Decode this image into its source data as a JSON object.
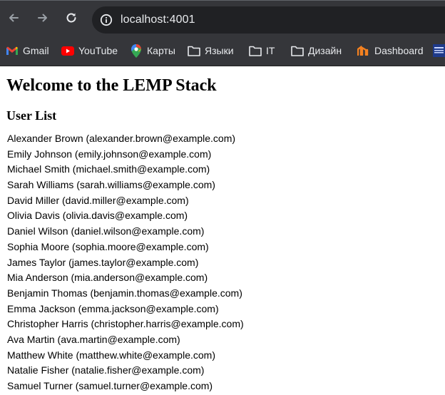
{
  "browser": {
    "url": "localhost:4001",
    "bookmarks": [
      {
        "label": "Gmail",
        "icon": "gmail-icon"
      },
      {
        "label": "YouTube",
        "icon": "youtube-icon"
      },
      {
        "label": "Карты",
        "icon": "maps-icon"
      },
      {
        "label": "Языки",
        "icon": "folder-icon"
      },
      {
        "label": "IT",
        "icon": "folder-icon"
      },
      {
        "label": "Дизайн",
        "icon": "folder-icon"
      },
      {
        "label": "Dashboard",
        "icon": "dashboard-icon"
      }
    ],
    "colors": {
      "chrome_bg": "#35363a",
      "omnibox_bg": "#202124",
      "text": "#e8eaed"
    }
  },
  "page": {
    "title": "Welcome to the LEMP Stack",
    "subtitle": "User List",
    "users": [
      "Alexander Brown (alexander.brown@example.com)",
      "Emily Johnson (emily.johnson@example.com)",
      "Michael Smith (michael.smith@example.com)",
      "Sarah Williams (sarah.williams@example.com)",
      "David Miller (david.miller@example.com)",
      "Olivia Davis (olivia.davis@example.com)",
      "Daniel Wilson (daniel.wilson@example.com)",
      "Sophia Moore (sophia.moore@example.com)",
      "James Taylor (james.taylor@example.com)",
      "Mia Anderson (mia.anderson@example.com)",
      "Benjamin Thomas (benjamin.thomas@example.com)",
      "Emma Jackson (emma.jackson@example.com)",
      "Christopher Harris (christopher.harris@example.com)",
      "Ava Martin (ava.martin@example.com)",
      "Matthew White (matthew.white@example.com)",
      "Natalie Fisher (natalie.fisher@example.com)",
      "Samuel Turner (samuel.turner@example.com)"
    ]
  }
}
